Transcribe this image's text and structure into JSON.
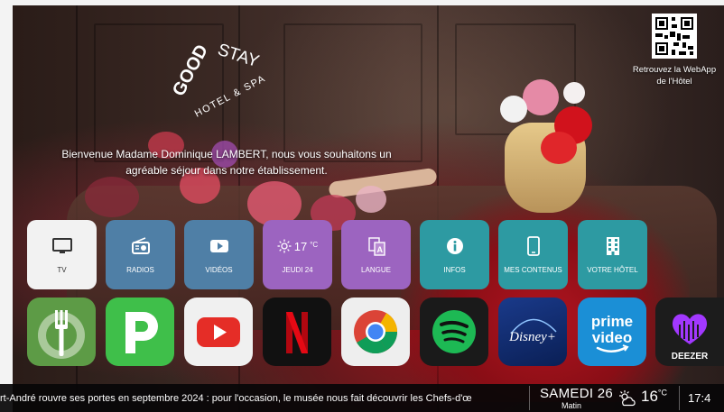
{
  "brand": {
    "logo_top": "GOOD",
    "logo_stay": "STAY",
    "logo_sub": "HOTEL & SPA"
  },
  "welcome": {
    "line1": "Bienvenue Madame Dominique LAMBERT, nous vous souhaitons un",
    "line2": "agréable séjour dans notre établissement."
  },
  "qr": {
    "line1": "Retrouvez la WebApp",
    "line2": "de l'Hôtel"
  },
  "tiles": [
    {
      "label": "TV",
      "icon": "tv-icon",
      "color": "#f2f2f2",
      "text_color": "#333333"
    },
    {
      "label": "RADIOS",
      "icon": "radio-icon",
      "color": "#4f7fa6"
    },
    {
      "label": "VIDÉOS",
      "icon": "video-play-icon",
      "color": "#4f7fa6"
    },
    {
      "label": "JEUDI 24",
      "icon": "sun-icon",
      "temp": "17",
      "unit": "°C",
      "color": "#9c64c0"
    },
    {
      "label": "LANGUE",
      "icon": "translate-icon",
      "color": "#9c64c0"
    },
    {
      "label": "INFOS",
      "icon": "info-icon",
      "color": "#2d9aa2"
    },
    {
      "label": "MES CONTENUS",
      "icon": "smartphone-icon",
      "color": "#2d9aa2"
    },
    {
      "label": "VOTRE HÔTEL",
      "icon": "building-icon",
      "color": "#2d9aa2"
    }
  ],
  "apps": [
    {
      "name": "restaurant-app",
      "icon": "fork-icon",
      "color": "#5d9b46"
    },
    {
      "name": "parking-app",
      "icon": "p-letter-icon",
      "color": "#3fbf4a"
    },
    {
      "name": "youtube-app",
      "icon": "youtube-icon",
      "color": "#f0f0f0"
    },
    {
      "name": "netflix-app",
      "icon": "netflix-icon",
      "color": "#111111"
    },
    {
      "name": "chrome-app",
      "icon": "chrome-icon",
      "color": "#eeeeee"
    },
    {
      "name": "spotify-app",
      "icon": "spotify-icon",
      "color": "#1a1a1a"
    },
    {
      "name": "disney-plus-app",
      "icon": "disney-plus-icon",
      "color": "#0d2a6b",
      "text": "Disney+"
    },
    {
      "name": "prime-video-app",
      "icon": "prime-video-icon",
      "color": "#1b8fd6",
      "text1": "prime",
      "text2": "video"
    },
    {
      "name": "deezer-app",
      "icon": "deezer-heart-icon",
      "color": "#1c1c1c",
      "text": "DEEZER"
    }
  ],
  "footer": {
    "ticker": "rt-André rouvre ses portes en septembre 2024 : pour l'occasion, le musée nous fait découvrir les Chefs-d'œ",
    "date": "SAMEDI 26",
    "period": "Matin",
    "temp": "16",
    "unit": "°C",
    "weather_icon": "partly-cloudy-icon",
    "time": "17:4"
  }
}
